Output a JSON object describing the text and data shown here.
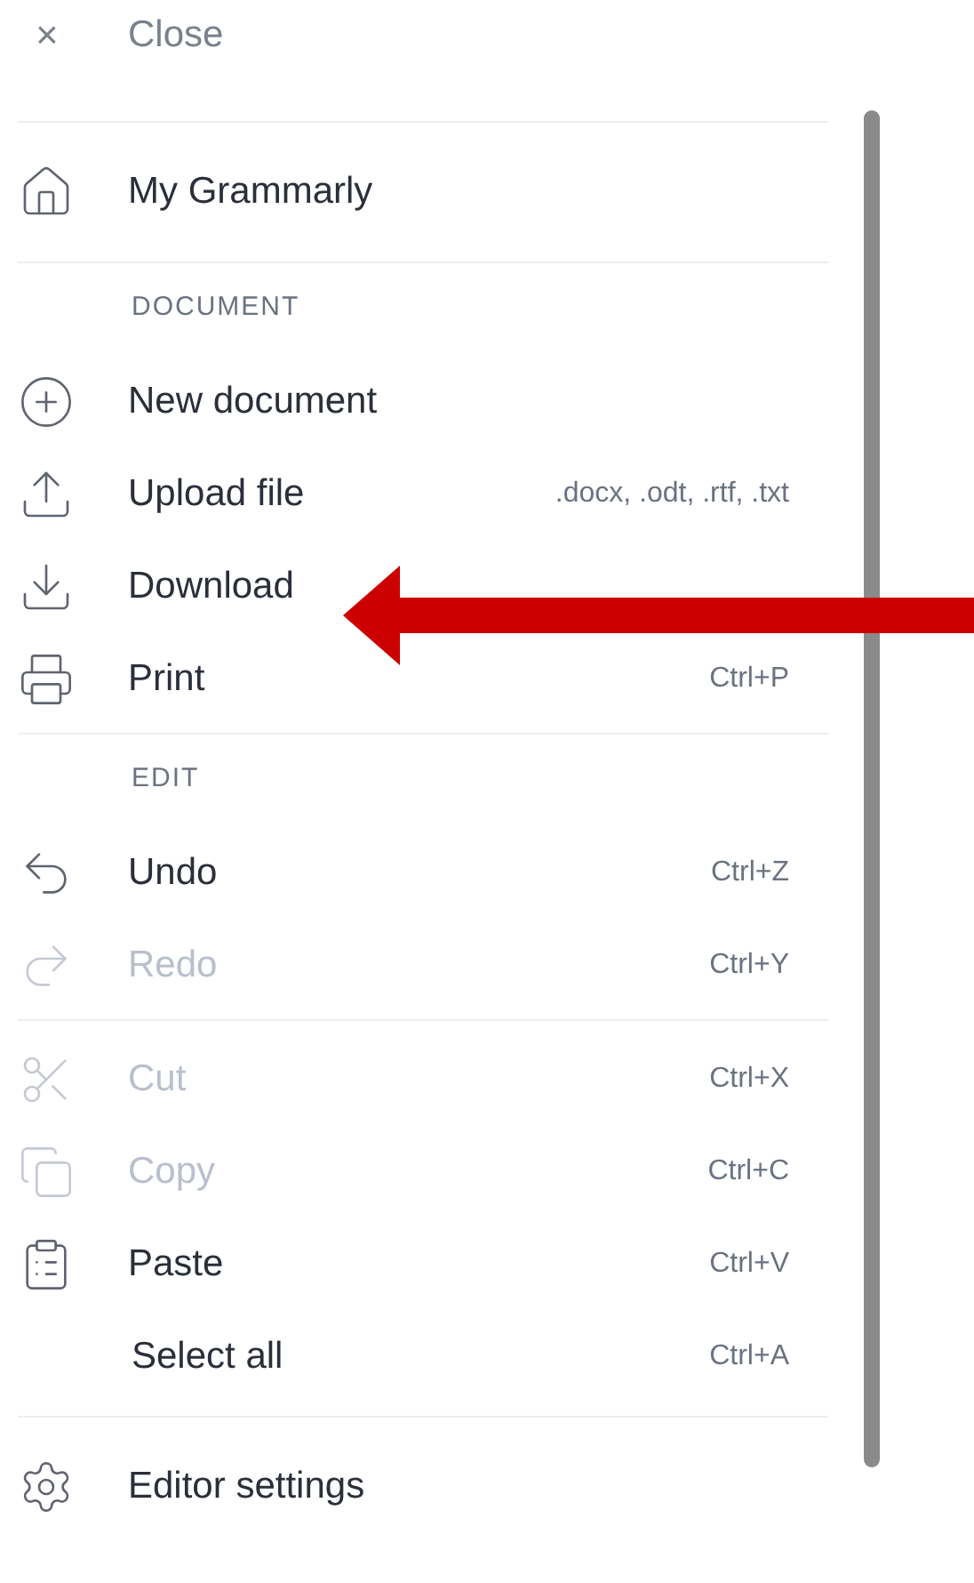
{
  "close": {
    "icon": "×",
    "label": "Close"
  },
  "groups": [
    {
      "items": [
        {
          "label": "My Grammarly",
          "disabled": false
        }
      ]
    },
    {
      "heading": "DOCUMENT",
      "items": [
        {
          "label": "New document",
          "disabled": false
        },
        {
          "label": "Upload file",
          "hint": ".docx, .odt, .rtf, .txt",
          "disabled": false
        },
        {
          "label": "Download",
          "disabled": false
        },
        {
          "label": "Print",
          "shortcut": "Ctrl+P",
          "disabled": false
        }
      ]
    },
    {
      "heading": "EDIT",
      "items": [
        {
          "label": "Undo",
          "shortcut": "Ctrl+Z",
          "disabled": false
        },
        {
          "label": "Redo",
          "shortcut": "Ctrl+Y",
          "disabled": true
        }
      ]
    },
    {
      "items": [
        {
          "label": "Cut",
          "shortcut": "Ctrl+X",
          "disabled": true
        },
        {
          "label": "Copy",
          "shortcut": "Ctrl+C",
          "disabled": true
        },
        {
          "label": "Paste",
          "shortcut": "Ctrl+V",
          "disabled": false
        },
        {
          "label": "Select all",
          "shortcut": "Ctrl+A",
          "disabled": false
        }
      ]
    },
    {
      "items": [
        {
          "label": "Editor settings",
          "disabled": false
        }
      ]
    }
  ]
}
